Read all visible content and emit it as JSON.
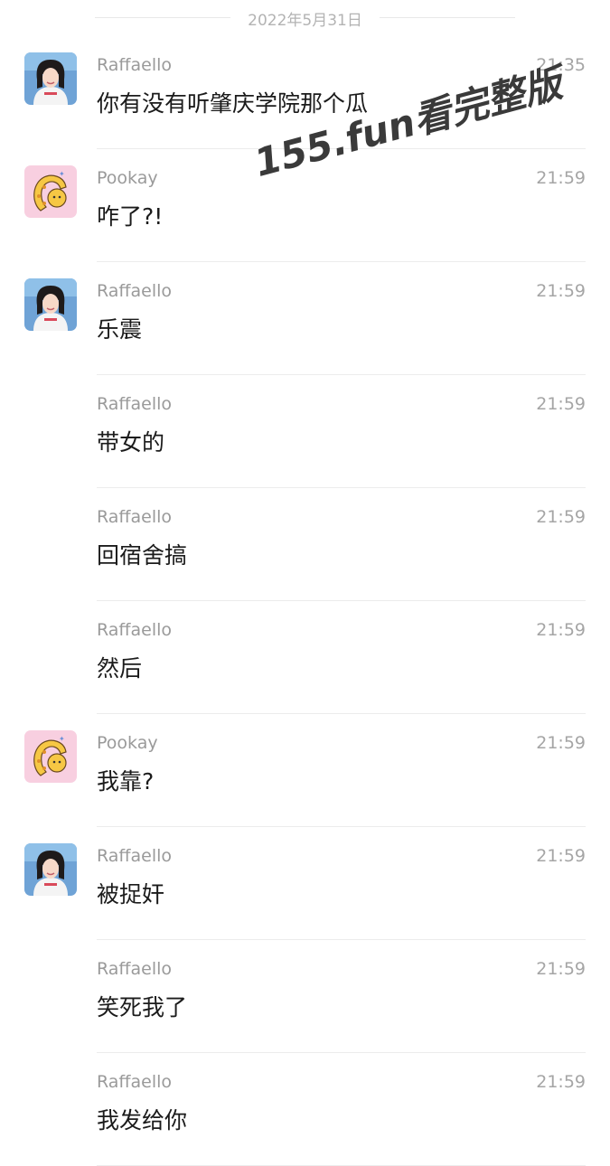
{
  "date_header": "2022年5月31日",
  "watermark": "155.fun看完整版",
  "senders": {
    "raffaello": {
      "name": "Raffaello",
      "avatar_icon": "girl-portrait-avatar-icon"
    },
    "pookay": {
      "name": "Pookay",
      "avatar_icon": "cartoon-cat-avatar-icon"
    }
  },
  "messages": [
    {
      "sender": "Raffaello",
      "time": "21:35",
      "text": "你有没有听肇庆学院那个瓜",
      "avatar": "raffaello"
    },
    {
      "sender": "Pookay",
      "time": "21:59",
      "text": "咋了?!",
      "avatar": "pookay"
    },
    {
      "sender": "Raffaello",
      "time": "21:59",
      "text": "乐震",
      "avatar": "raffaello"
    },
    {
      "sender": "Raffaello",
      "time": "21:59",
      "text": "带女的",
      "avatar": ""
    },
    {
      "sender": "Raffaello",
      "time": "21:59",
      "text": "回宿舍搞",
      "avatar": ""
    },
    {
      "sender": "Raffaello",
      "time": "21:59",
      "text": "然后",
      "avatar": ""
    },
    {
      "sender": "Pookay",
      "time": "21:59",
      "text": "我靠?",
      "avatar": "pookay"
    },
    {
      "sender": "Raffaello",
      "time": "21:59",
      "text": "被捉奸",
      "avatar": "raffaello"
    },
    {
      "sender": "Raffaello",
      "time": "21:59",
      "text": "笑死我了",
      "avatar": ""
    },
    {
      "sender": "Raffaello",
      "time": "21:59",
      "text": "我发给你",
      "avatar": ""
    }
  ]
}
